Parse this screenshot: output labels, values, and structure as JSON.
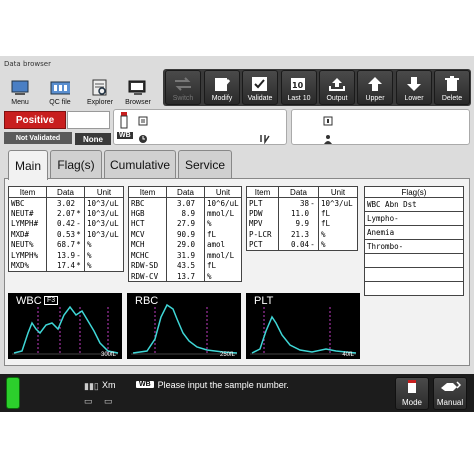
{
  "window": {
    "title": "Data browser"
  },
  "toolbar": {
    "left": [
      {
        "label": "Menu",
        "icon": "menu-icon"
      },
      {
        "label": "QC file",
        "icon": "qc-file-icon"
      },
      {
        "label": "Explorer",
        "icon": "explorer-icon"
      },
      {
        "label": "Browser",
        "icon": "browser-icon"
      }
    ],
    "right": [
      {
        "label": "Switch",
        "icon": "switch-icon",
        "disabled": true
      },
      {
        "label": "Modify",
        "icon": "modify-icon"
      },
      {
        "label": "Validate",
        "icon": "validate-icon"
      },
      {
        "label": "Last 10",
        "icon": "last10-icon"
      },
      {
        "label": "Output",
        "icon": "output-icon"
      },
      {
        "label": "Upper",
        "icon": "upper-icon"
      },
      {
        "label": "Lower",
        "icon": "lower-icon"
      },
      {
        "label": "Delete",
        "icon": "delete-icon"
      }
    ]
  },
  "status": {
    "result": "Positive",
    "validation": "Not Validated",
    "none_label": "None",
    "colors": {
      "positive": "#c81e1e",
      "indicator": "#2ccf2c"
    }
  },
  "sample": {
    "mode_tag": "WB"
  },
  "tabs": [
    {
      "label": "Main",
      "active": true
    },
    {
      "label": "Flag(s)",
      "active": false
    },
    {
      "label": "Cumulative",
      "active": false
    },
    {
      "label": "Service",
      "active": false
    }
  ],
  "table_headers": {
    "item": "Item",
    "data": "Data",
    "unit": "Unit"
  },
  "wbc_table": [
    {
      "item": "WBC",
      "data": "3.02",
      "flag": "",
      "unit": "10^3/uL"
    },
    {
      "item": "NEUT#",
      "data": "2.07",
      "flag": "*",
      "unit": "10^3/uL"
    },
    {
      "item": "LYMPH#",
      "data": "0.42",
      "flag": "-",
      "unit": "10^3/uL"
    },
    {
      "item": "MXD#",
      "data": "0.53",
      "flag": "*",
      "unit": "10^3/uL"
    },
    {
      "item": "NEUT%",
      "data": "68.7",
      "flag": "*",
      "unit": "%"
    },
    {
      "item": "LYMPH%",
      "data": "13.9",
      "flag": "-",
      "unit": "%"
    },
    {
      "item": "MXD%",
      "data": "17.4",
      "flag": "*",
      "unit": "%"
    }
  ],
  "rbc_table": [
    {
      "item": "RBC",
      "data": "3.07",
      "flag": "",
      "unit": "10^6/uL"
    },
    {
      "item": "HGB",
      "data": "8.9",
      "flag": "",
      "unit": "mmol/L"
    },
    {
      "item": "HCT",
      "data": "27.9",
      "flag": "",
      "unit": "%"
    },
    {
      "item": "MCV",
      "data": "90.9",
      "flag": "",
      "unit": "fL"
    },
    {
      "item": "MCH",
      "data": "29.0",
      "flag": "",
      "unit": "amol"
    },
    {
      "item": "MCHC",
      "data": "31.9",
      "flag": "",
      "unit": "mmol/L"
    },
    {
      "item": "RDW-SD",
      "data": "43.5",
      "flag": "",
      "unit": "fL"
    },
    {
      "item": "RDW-CV",
      "data": "13.7",
      "flag": "",
      "unit": "%"
    }
  ],
  "plt_table": [
    {
      "item": "PLT",
      "data": "38",
      "flag": "-",
      "unit": "10^3/uL"
    },
    {
      "item": "PDW",
      "data": "11.0",
      "flag": "",
      "unit": "fL"
    },
    {
      "item": "MPV",
      "data": "9.9",
      "flag": "",
      "unit": "fL"
    },
    {
      "item": "P-LCR",
      "data": "21.3",
      "flag": "",
      "unit": "%"
    },
    {
      "item": "PCT",
      "data": "0.04",
      "flag": "-",
      "unit": "%"
    }
  ],
  "flags": {
    "header": "Flag(s)",
    "items": [
      "WBC Abn Dst",
      "Lympho-",
      "Anemia",
      "Thrombo-",
      "",
      "",
      ""
    ]
  },
  "histograms": [
    {
      "label": "WBC",
      "tag": "F3",
      "unit": "300fL"
    },
    {
      "label": "RBC",
      "tag": "",
      "unit": "250fL"
    },
    {
      "label": "PLT",
      "tag": "",
      "unit": "40fL"
    }
  ],
  "bottom": {
    "mode_tag": "WB",
    "message": "Please input the sample number.",
    "xm_label": "Xm",
    "buttons": [
      {
        "label": "Mode",
        "icon": "mode-icon"
      },
      {
        "label": "Manual",
        "icon": "manual-icon"
      }
    ]
  }
}
